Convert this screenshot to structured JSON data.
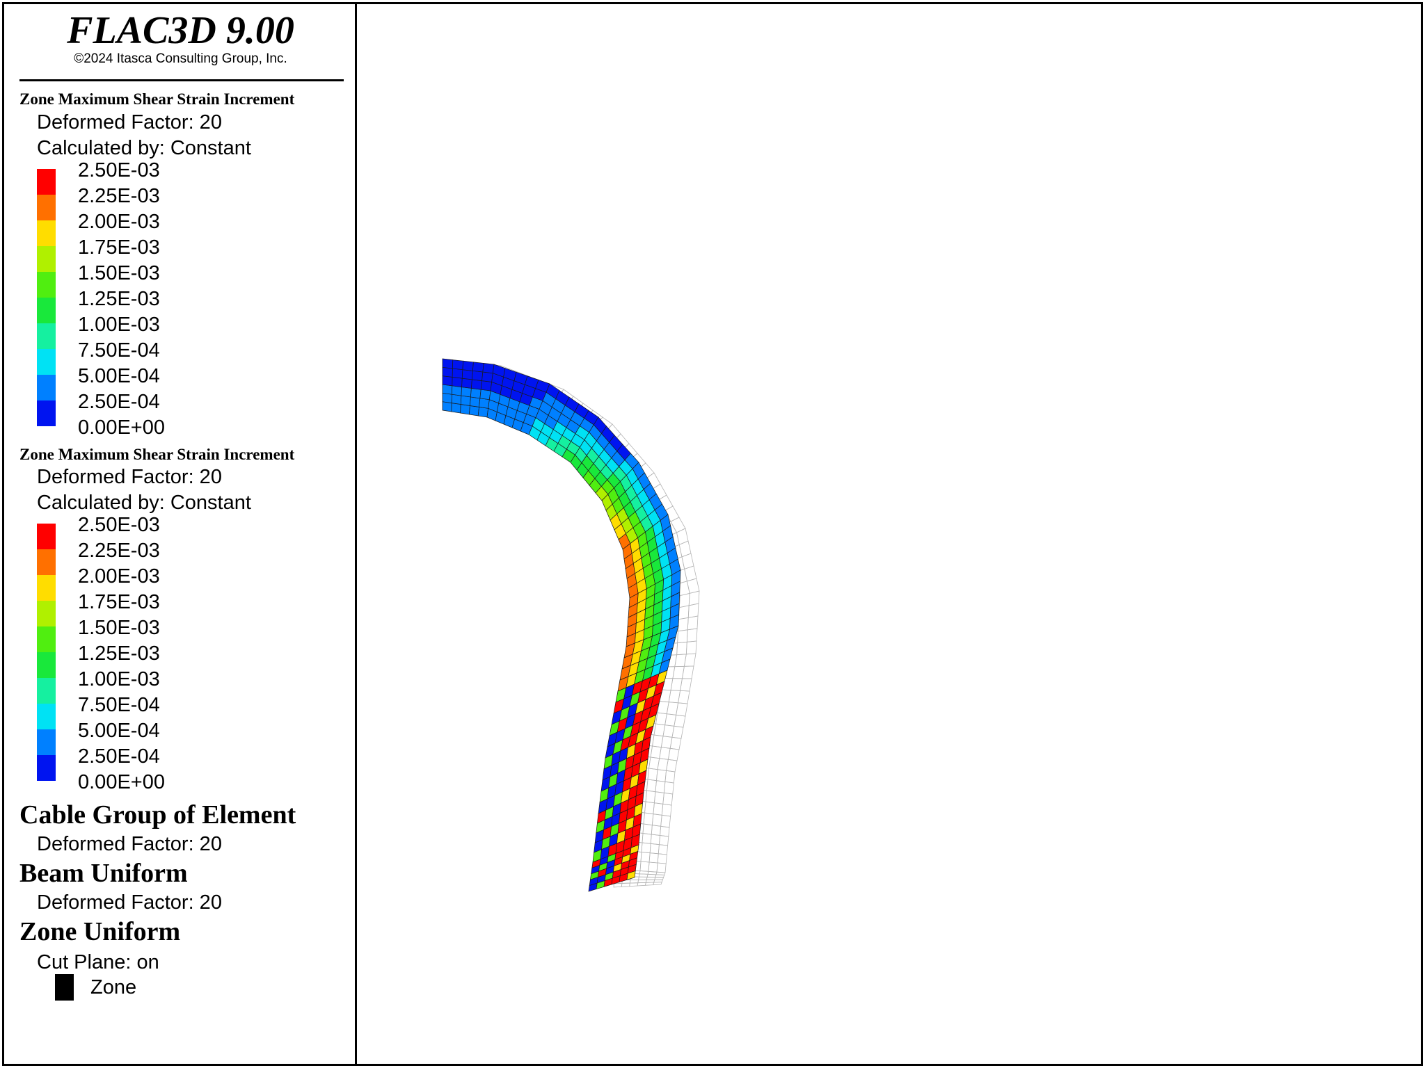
{
  "app": {
    "title": "FLAC3D 9.00",
    "copyright": "©2024 Itasca Consulting Group, Inc."
  },
  "legend": {
    "contours": [
      {
        "title": "Zone Maximum Shear Strain Increment",
        "deformed": "Deformed Factor: 20",
        "calculated": "Calculated by: Constant",
        "scale": [
          {
            "label": "2.50E-03",
            "color": "#ff0000"
          },
          {
            "label": "2.25E-03",
            "color": "#ff7000"
          },
          {
            "label": "2.00E-03",
            "color": "#ffdd00"
          },
          {
            "label": "1.75E-03",
            "color": "#b0f000"
          },
          {
            "label": "1.50E-03",
            "color": "#50ee10"
          },
          {
            "label": "1.25E-03",
            "color": "#19e83b"
          },
          {
            "label": "1.00E-03",
            "color": "#15f0a0"
          },
          {
            "label": "7.50E-04",
            "color": "#00e2f4"
          },
          {
            "label": "5.00E-04",
            "color": "#0080ff"
          },
          {
            "label": "2.50E-04",
            "color": "#0014f0"
          },
          {
            "label": "0.00E+00",
            "color": ""
          }
        ]
      },
      {
        "title": "Zone Maximum Shear Strain Increment",
        "deformed": "Deformed Factor: 20",
        "calculated": "Calculated by: Constant",
        "scale": [
          {
            "label": "2.50E-03",
            "color": "#ff0000"
          },
          {
            "label": "2.25E-03",
            "color": "#ff7000"
          },
          {
            "label": "2.00E-03",
            "color": "#ffdd00"
          },
          {
            "label": "1.75E-03",
            "color": "#b0f000"
          },
          {
            "label": "1.50E-03",
            "color": "#50ee10"
          },
          {
            "label": "1.25E-03",
            "color": "#19e83b"
          },
          {
            "label": "1.00E-03",
            "color": "#15f0a0"
          },
          {
            "label": "7.50E-04",
            "color": "#00e2f4"
          },
          {
            "label": "5.00E-04",
            "color": "#0080ff"
          },
          {
            "label": "2.50E-04",
            "color": "#0014f0"
          },
          {
            "label": "0.00E+00",
            "color": ""
          }
        ]
      }
    ],
    "cable": {
      "title": "Cable Group of Element",
      "deformed": "Deformed Factor: 20"
    },
    "beam": {
      "title": "Beam Uniform",
      "deformed": "Deformed Factor: 20"
    },
    "zone": {
      "title": "Zone Uniform",
      "cut_plane": "Cut Plane: on",
      "item": "Zone",
      "color": "#000000"
    }
  }
}
